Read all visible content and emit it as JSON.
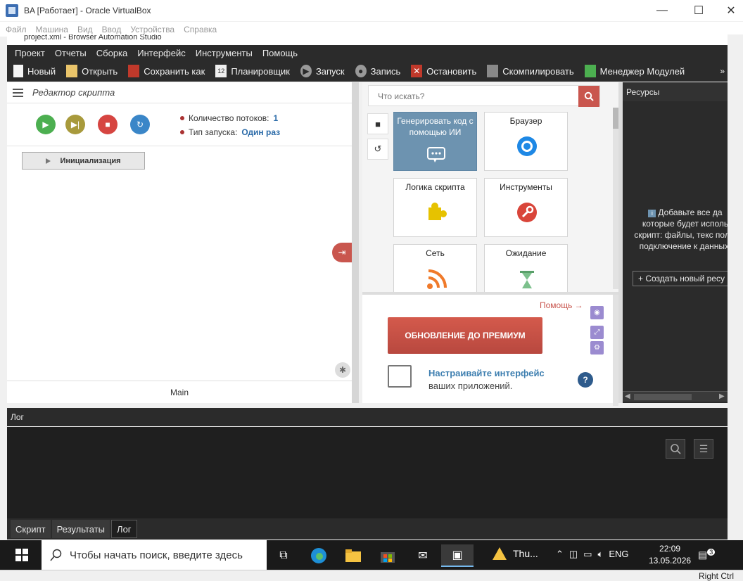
{
  "vbox": {
    "title": "BA [Работает] - Oracle VirtualBox",
    "menu": [
      "Файл",
      "Машина",
      "Вид",
      "Ввод",
      "Устройства",
      "Справка"
    ],
    "status_right": "Right Ctrl"
  },
  "bas": {
    "title": "project.xml - Browser Automation Studio",
    "menu": [
      "Проект",
      "Отчеты",
      "Сборка",
      "Интерфейс",
      "Инструменты",
      "Помощь"
    ],
    "toolbar": [
      "Новый",
      "Открыть",
      "Сохранить как",
      "Планировщик",
      "Запуск",
      "Запись",
      "Остановить",
      "Скомпилировать",
      "Менеджер Модулей"
    ],
    "toolbar_more": "»"
  },
  "editor": {
    "title": "Редактор скрипта",
    "threads_label": "Количество потоков:",
    "threads_value": "1",
    "run_type_label": "Тип запуска:",
    "run_type_value": "Один раз",
    "init_button": "Инициализация",
    "tab_main": "Main"
  },
  "toolbox": {
    "search_placeholder": "Что искать?",
    "cards": [
      "Генерировать код с помощью ИИ",
      "Браузер",
      "Логика скрипта",
      "Инструменты",
      "Сеть",
      "Ожидание"
    ],
    "help_link": "Помощь →",
    "premium_button": "ОБНОВЛЕНИЕ ДО ПРЕМИУМ",
    "tip_title": "Настраивайте интерфейс",
    "tip_text": "ваших приложений.",
    "question": "?"
  },
  "resources": {
    "title": "Ресурсы",
    "empty_text": "Добавьте все да которые будет исполь скрипт: файлы, текс поля, подключение к данных.",
    "create_button": "+ Создать новый ресу"
  },
  "log": {
    "title": "Лог",
    "tabs": [
      "Скрипт",
      "Результаты",
      "Лог"
    ]
  },
  "taskbar": {
    "search_placeholder": "Чтобы начать поиск, введите здесь",
    "weather": "Thu...",
    "lang": "ENG",
    "time": "22:09",
    "date": "13.05.2026",
    "notif_count": "3"
  }
}
